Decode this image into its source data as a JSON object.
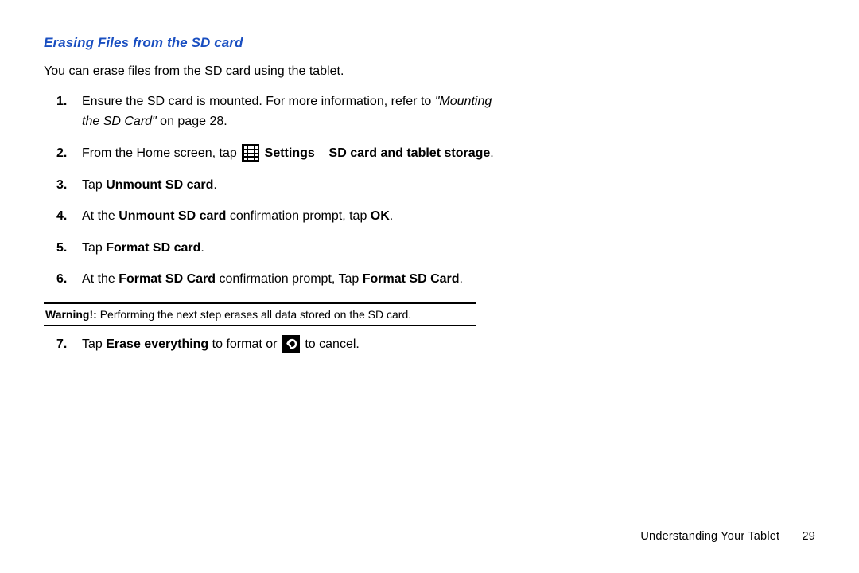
{
  "heading": "Erasing Files from the SD card",
  "intro": "You can erase files from the SD card using the tablet.",
  "steps": {
    "s1_a": "Ensure the SD card is mounted. For more information, refer to ",
    "s1_ref": "\"Mounting the SD Card\"",
    "s1_b": "  on page 28.",
    "s2_a": "From the Home screen, tap ",
    "s2_b": " Settings",
    "s2_c": "SD card and tablet storage",
    "s2_d": ".",
    "s3_a": "Tap ",
    "s3_b": "Unmount SD card",
    "s3_c": ".",
    "s4_a": "At the ",
    "s4_b": "Unmount SD card",
    "s4_c": " confirmation prompt, tap ",
    "s4_d": "OK",
    "s4_e": ".",
    "s5_a": "Tap ",
    "s5_b": "Format SD card",
    "s5_c": ".",
    "s6_a": "At the ",
    "s6_b": "Format SD Card",
    "s6_c": " confirmation prompt, Tap ",
    "s6_d": "Format SD Card",
    "s6_e": ".",
    "s7_a": "Tap ",
    "s7_b": "Erase everything",
    "s7_c": " to format or ",
    "s7_d": " to cancel."
  },
  "warning": {
    "label": "Warning!:",
    "text": " Performing the next step erases all data stored on the SD card."
  },
  "footer": {
    "section": "Understanding Your Tablet",
    "page": "29"
  },
  "icons": {
    "apps": "apps-grid-icon",
    "back": "back-icon"
  }
}
